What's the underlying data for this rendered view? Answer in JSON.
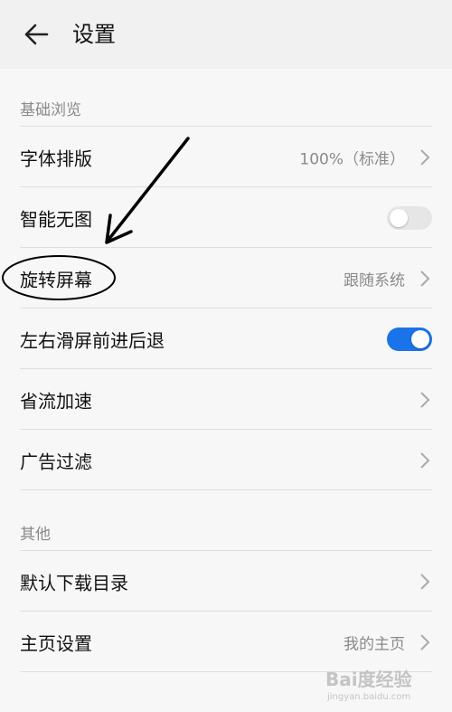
{
  "header": {
    "title": "设置"
  },
  "sections": [
    {
      "label": "基础浏览"
    },
    {
      "label": "其他"
    }
  ],
  "rows": {
    "font": {
      "label": "字体排版",
      "value": "100%（标准）"
    },
    "no_image": {
      "label": "智能无图",
      "toggle": "off"
    },
    "rotate": {
      "label": "旋转屏幕",
      "value": "跟随系统"
    },
    "swipe": {
      "label": "左右滑屏前进后退",
      "toggle": "on"
    },
    "data_saver": {
      "label": "省流加速"
    },
    "ad_filter": {
      "label": "广告过滤"
    },
    "download_dir": {
      "label": "默认下载目录"
    },
    "homepage": {
      "label": "主页设置",
      "value": "我的主页"
    }
  },
  "watermark": {
    "brand": "Bai度经验",
    "url": "jingyan.baidu.com"
  },
  "colors": {
    "accent": "#1a73e8",
    "annotation": "#000000"
  },
  "icons": {
    "back": "back-arrow-icon",
    "chevron": "chevron-right-icon"
  }
}
